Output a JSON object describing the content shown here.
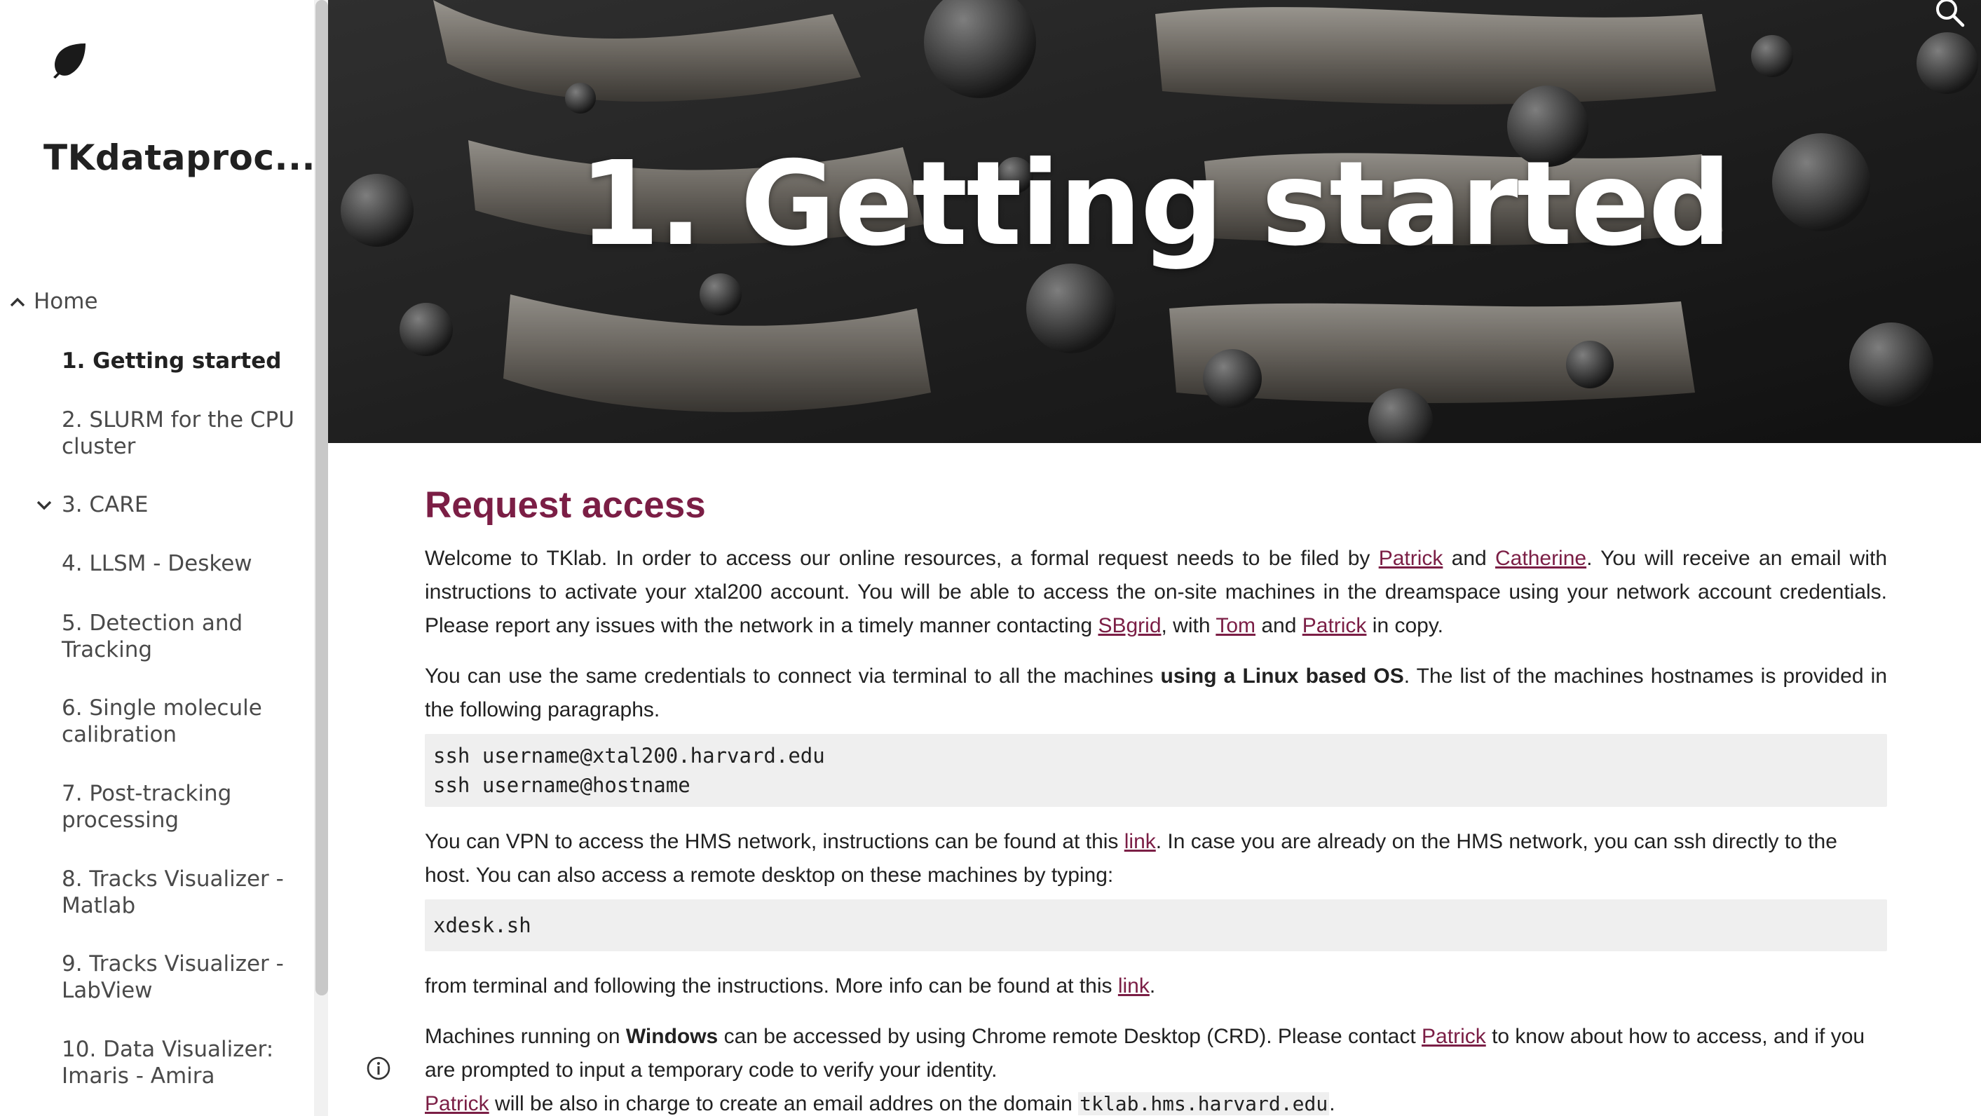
{
  "sidebar": {
    "site_title": "TKdataproc...",
    "nav": [
      {
        "label": "Home",
        "expanded": true
      },
      {
        "label": "1. Getting started",
        "active": true
      },
      {
        "label": "2. SLURM for the CPU cluster"
      },
      {
        "label": "3. CARE",
        "collapsed": true
      },
      {
        "label": "4. LLSM - Deskew"
      },
      {
        "label": "5. Detection and Tracking"
      },
      {
        "label": "6. Single molecule calibration"
      },
      {
        "label": "7. Post-tracking processing"
      },
      {
        "label": "8. Tracks Visualizer - Matlab"
      },
      {
        "label": "9. Tracks Visualizer - LabView"
      },
      {
        "label": "10. Data Visualizer: Imaris - Amira"
      }
    ]
  },
  "hero": {
    "title": "1. Getting started"
  },
  "content": {
    "heading": "Request access",
    "p1": {
      "t1": "Welcome to TKlab. In order to access our online resources, a formal request needs to be filed by ",
      "l1": "Patrick",
      "t2": " and ",
      "l2": "Catherine",
      "t3": ". You will receive an email with instructions to activate your xtal200 account. You will be able to access the on-site machines in the dreamspace using your network account credentials. Please report any issues with the network in a timely manner contacting ",
      "l3": "SBgrid",
      "t4": ", with ",
      "l4": "Tom",
      "t5": " and ",
      "l5": "Patrick",
      "t6": " in copy."
    },
    "p2": {
      "t1": "You can use the same credentials to connect via terminal to all the machines ",
      "b1": "using a Linux based OS",
      "t2": ". The list of the machines hostnames is provided in the following paragraphs."
    },
    "code1": [
      "ssh username@xtal200.harvard.edu",
      "ssh username@hostname"
    ],
    "p3": {
      "t1": "You can VPN to access the HMS network, instructions can be found at this ",
      "l1": "link",
      "t2": ". In case you are already on the HMS network, you can ssh directly to the host. You can also access a remote desktop on these machines by typing:"
    },
    "code2": [
      "xdesk.sh"
    ],
    "p4": {
      "t1": "from terminal and following the instructions. More info can be found at this ",
      "l1": "link",
      "t2": "."
    },
    "p5": {
      "t1": "Machines running on ",
      "b1": "Windows",
      "t2": " can be accessed by using Chrome remote Desktop (CRD). Please contact ",
      "l1": "Patrick",
      "t3": " to know about how to access, and if you are prompted to input a temporary code to verify your identity."
    },
    "p6": {
      "l1": "Patrick",
      "t1": " will be also in charge to create an email addres on the domain ",
      "c1": "tklab.hms.harvard.edu",
      "t2": "."
    }
  },
  "colors": {
    "accent": "#7b1e45",
    "code_bg": "#efefef"
  },
  "icons": [
    "leaf-logo-icon",
    "chevron-up-icon",
    "chevron-down-icon",
    "search-icon",
    "info-icon"
  ]
}
